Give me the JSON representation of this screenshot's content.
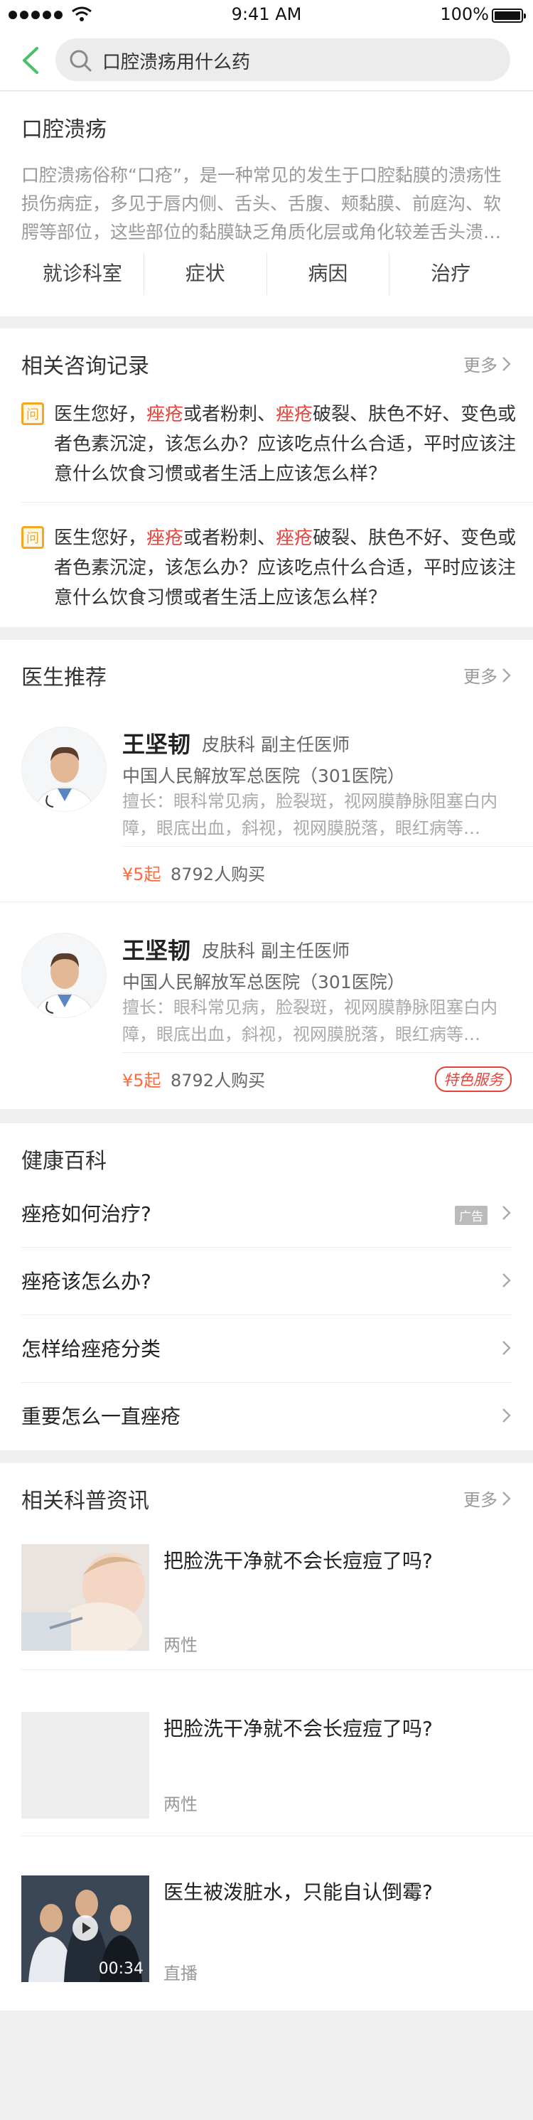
{
  "status_bar": {
    "time": "9:41 AM",
    "battery": "100%"
  },
  "search": {
    "query": "口腔溃疡用什么药"
  },
  "intro": {
    "title": "口腔溃疡",
    "description": "口腔溃疡俗称“口疮”，是一种常见的发生于口腔黏膜的溃疡性损伤病症，多见于唇内侧、舌头、舌腹、颊黏膜、前庭沟、软腭等部位，这些部位的黏膜缺乏角质化层或角化较差舌头溃…",
    "tabs": [
      "就诊科室",
      "症状",
      "病因",
      "治疗"
    ]
  },
  "consult": {
    "title": "相关咨询记录",
    "more": "更多",
    "badge": "问",
    "items": [
      {
        "p1": "医生您好，",
        "h1": "痤疮",
        "p2": "或者粉刺、",
        "h2": "痤疮",
        "p3": "破裂、肤色不好、变色或者色素沉淀，该怎么办？应该吃点什么合适，平时应该注意什么饮食习惯或者生活上应该怎么样？"
      },
      {
        "p1": "医生您好，",
        "h1": "痤疮",
        "p2": "或者粉刺、",
        "h2": "痤疮",
        "p3": "破裂、肤色不好、变色或者色素沉淀，该怎么办？应该吃点什么合适，平时应该注意什么饮食习惯或者生活上应该怎么样？"
      }
    ]
  },
  "doctors": {
    "title": "医生推荐",
    "more": "更多",
    "items": [
      {
        "name": "王坚韧",
        "title": "皮肤科 副主任医师",
        "hospital": "中国人民解放军总医院（301医院）",
        "skill": "擅长：眼科常见病，脸裂斑，视网膜静脉阻塞白内障，眼底出血，斜视，视网膜脱落，眼红病等…",
        "price": "¥5起",
        "buyers": "8792人购买",
        "tag": ""
      },
      {
        "name": "王坚韧",
        "title": "皮肤科 副主任医师",
        "hospital": "中国人民解放军总医院（301医院）",
        "skill": "擅长：眼科常见病，脸裂斑，视网膜静脉阻塞白内障，眼底出血，斜视，视网膜脱落，眼红病等…",
        "price": "¥5起",
        "buyers": "8792人购买",
        "tag": "特色服务"
      }
    ]
  },
  "wiki": {
    "title": "健康百科",
    "items": [
      {
        "label": "痤疮如何治疗?",
        "ad": "广告"
      },
      {
        "label": "痤疮该怎么办?",
        "ad": ""
      },
      {
        "label": "怎样给痤疮分类",
        "ad": ""
      },
      {
        "label": "重要怎么一直痤疮",
        "ad": ""
      }
    ]
  },
  "news": {
    "title": "相关科普资讯",
    "more": "更多",
    "items": [
      {
        "title": "把脸洗干净就不会长痘痘了吗?",
        "category": "两性",
        "thumb": "baby-photo"
      },
      {
        "title": "把脸洗干净就不会长痘痘了吗?",
        "category": "两性",
        "thumb": "empty-placeholder"
      },
      {
        "title": "医生被泼脏水，只能自认倒霉?",
        "category": "直播",
        "thumb": "video-doctors",
        "duration": "00:34"
      }
    ]
  },
  "colors": {
    "accent_green": "#4cbf6a",
    "highlight_red": "#e8423b",
    "price_orange": "#ff6a3d",
    "badge_orange": "#f5a623"
  }
}
